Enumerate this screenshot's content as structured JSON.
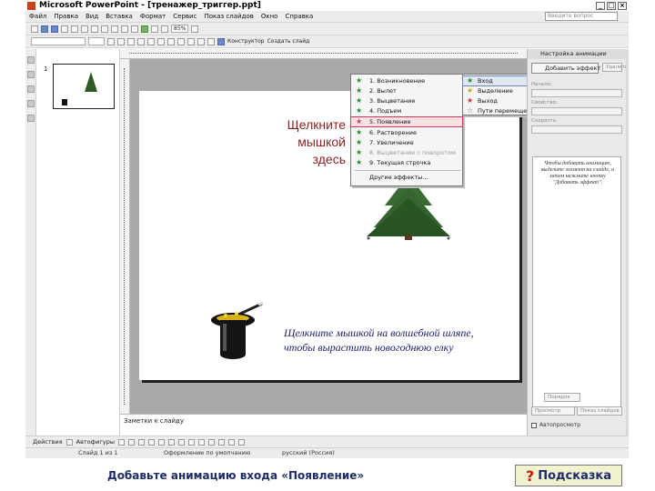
{
  "window": {
    "title": "Microsoft PowerPoint - [тренажер_триггер.ppt]",
    "controls": [
      "_",
      "□",
      "×"
    ]
  },
  "menubar": {
    "items": [
      "Файл",
      "Правка",
      "Вид",
      "Вставка",
      "Формат",
      "Сервис",
      "Показ слайдов",
      "Окно",
      "Справка"
    ],
    "help_placeholder": "Введите вопрос"
  },
  "toolbar": {
    "zoom": "85%",
    "designer_label": "Конструктор",
    "new_slide_label": "Создать слайд"
  },
  "slide_panel": {
    "slide_number": "1"
  },
  "slide": {
    "click_text": "Щелкните\nмышкой\nздесь",
    "hint_text": "Щелкните мышкой на волшебной шляпе,\nчтобы вырастить новогоднюю елку"
  },
  "context_menu": {
    "items": [
      {
        "label": "1. Возникновение",
        "selected": false,
        "dim": false
      },
      {
        "label": "2. Вылет",
        "selected": false,
        "dim": false
      },
      {
        "label": "3. Выцветание",
        "selected": false,
        "dim": false
      },
      {
        "label": "4. Подъем",
        "selected": false,
        "dim": false
      },
      {
        "label": "5. Появление",
        "selected": true,
        "dim": false
      },
      {
        "label": "6. Растворение",
        "selected": false,
        "dim": false
      },
      {
        "label": "7. Увеличение",
        "selected": false,
        "dim": false
      },
      {
        "label": "8. Выцветание с поворотом",
        "selected": false,
        "dim": true
      },
      {
        "label": "9. Текущая строчка",
        "selected": false,
        "dim": false
      }
    ],
    "more_label": "Другие эффекты..."
  },
  "submenu": {
    "items": [
      {
        "label": "Вход",
        "selected": true,
        "color": "#2a8a2a"
      },
      {
        "label": "Выделение",
        "selected": false,
        "color": "#c9a41a"
      },
      {
        "label": "Выход",
        "selected": false,
        "color": "#c83232"
      },
      {
        "label": "Пути перемещения",
        "selected": false,
        "color": "#777777"
      }
    ]
  },
  "taskpane": {
    "title": "Настройка анимации",
    "add_effect_label": "Добавить эффект",
    "remove_label": "Удалить",
    "start_label": "Начало:",
    "property_label": "Свойство:",
    "speed_label": "Скорость:",
    "list_message": "Чтобы добавить анимацию, выделите элемент на слайде, а затем нажмите кнопку \"Добавить эффект\".",
    "reorder_label": "Порядок",
    "play_label": "Просмотр",
    "slideshow_label": "Показ слайдов",
    "autopreview_label": "Автопросмотр"
  },
  "notes": {
    "placeholder": "Заметки к слайду"
  },
  "drawbar": {
    "actions_label": "Действия",
    "autoshapes_label": "Автофигуры"
  },
  "statusbar": {
    "slide_info": "Слайд 1 из 1",
    "design": "Оформление по умолчанию",
    "language": "русский (Россия)"
  },
  "instruction": {
    "text": "Добавьте анимацию входа «Появление»"
  },
  "hint_button": {
    "qmark": "?",
    "label": "Подсказка"
  }
}
